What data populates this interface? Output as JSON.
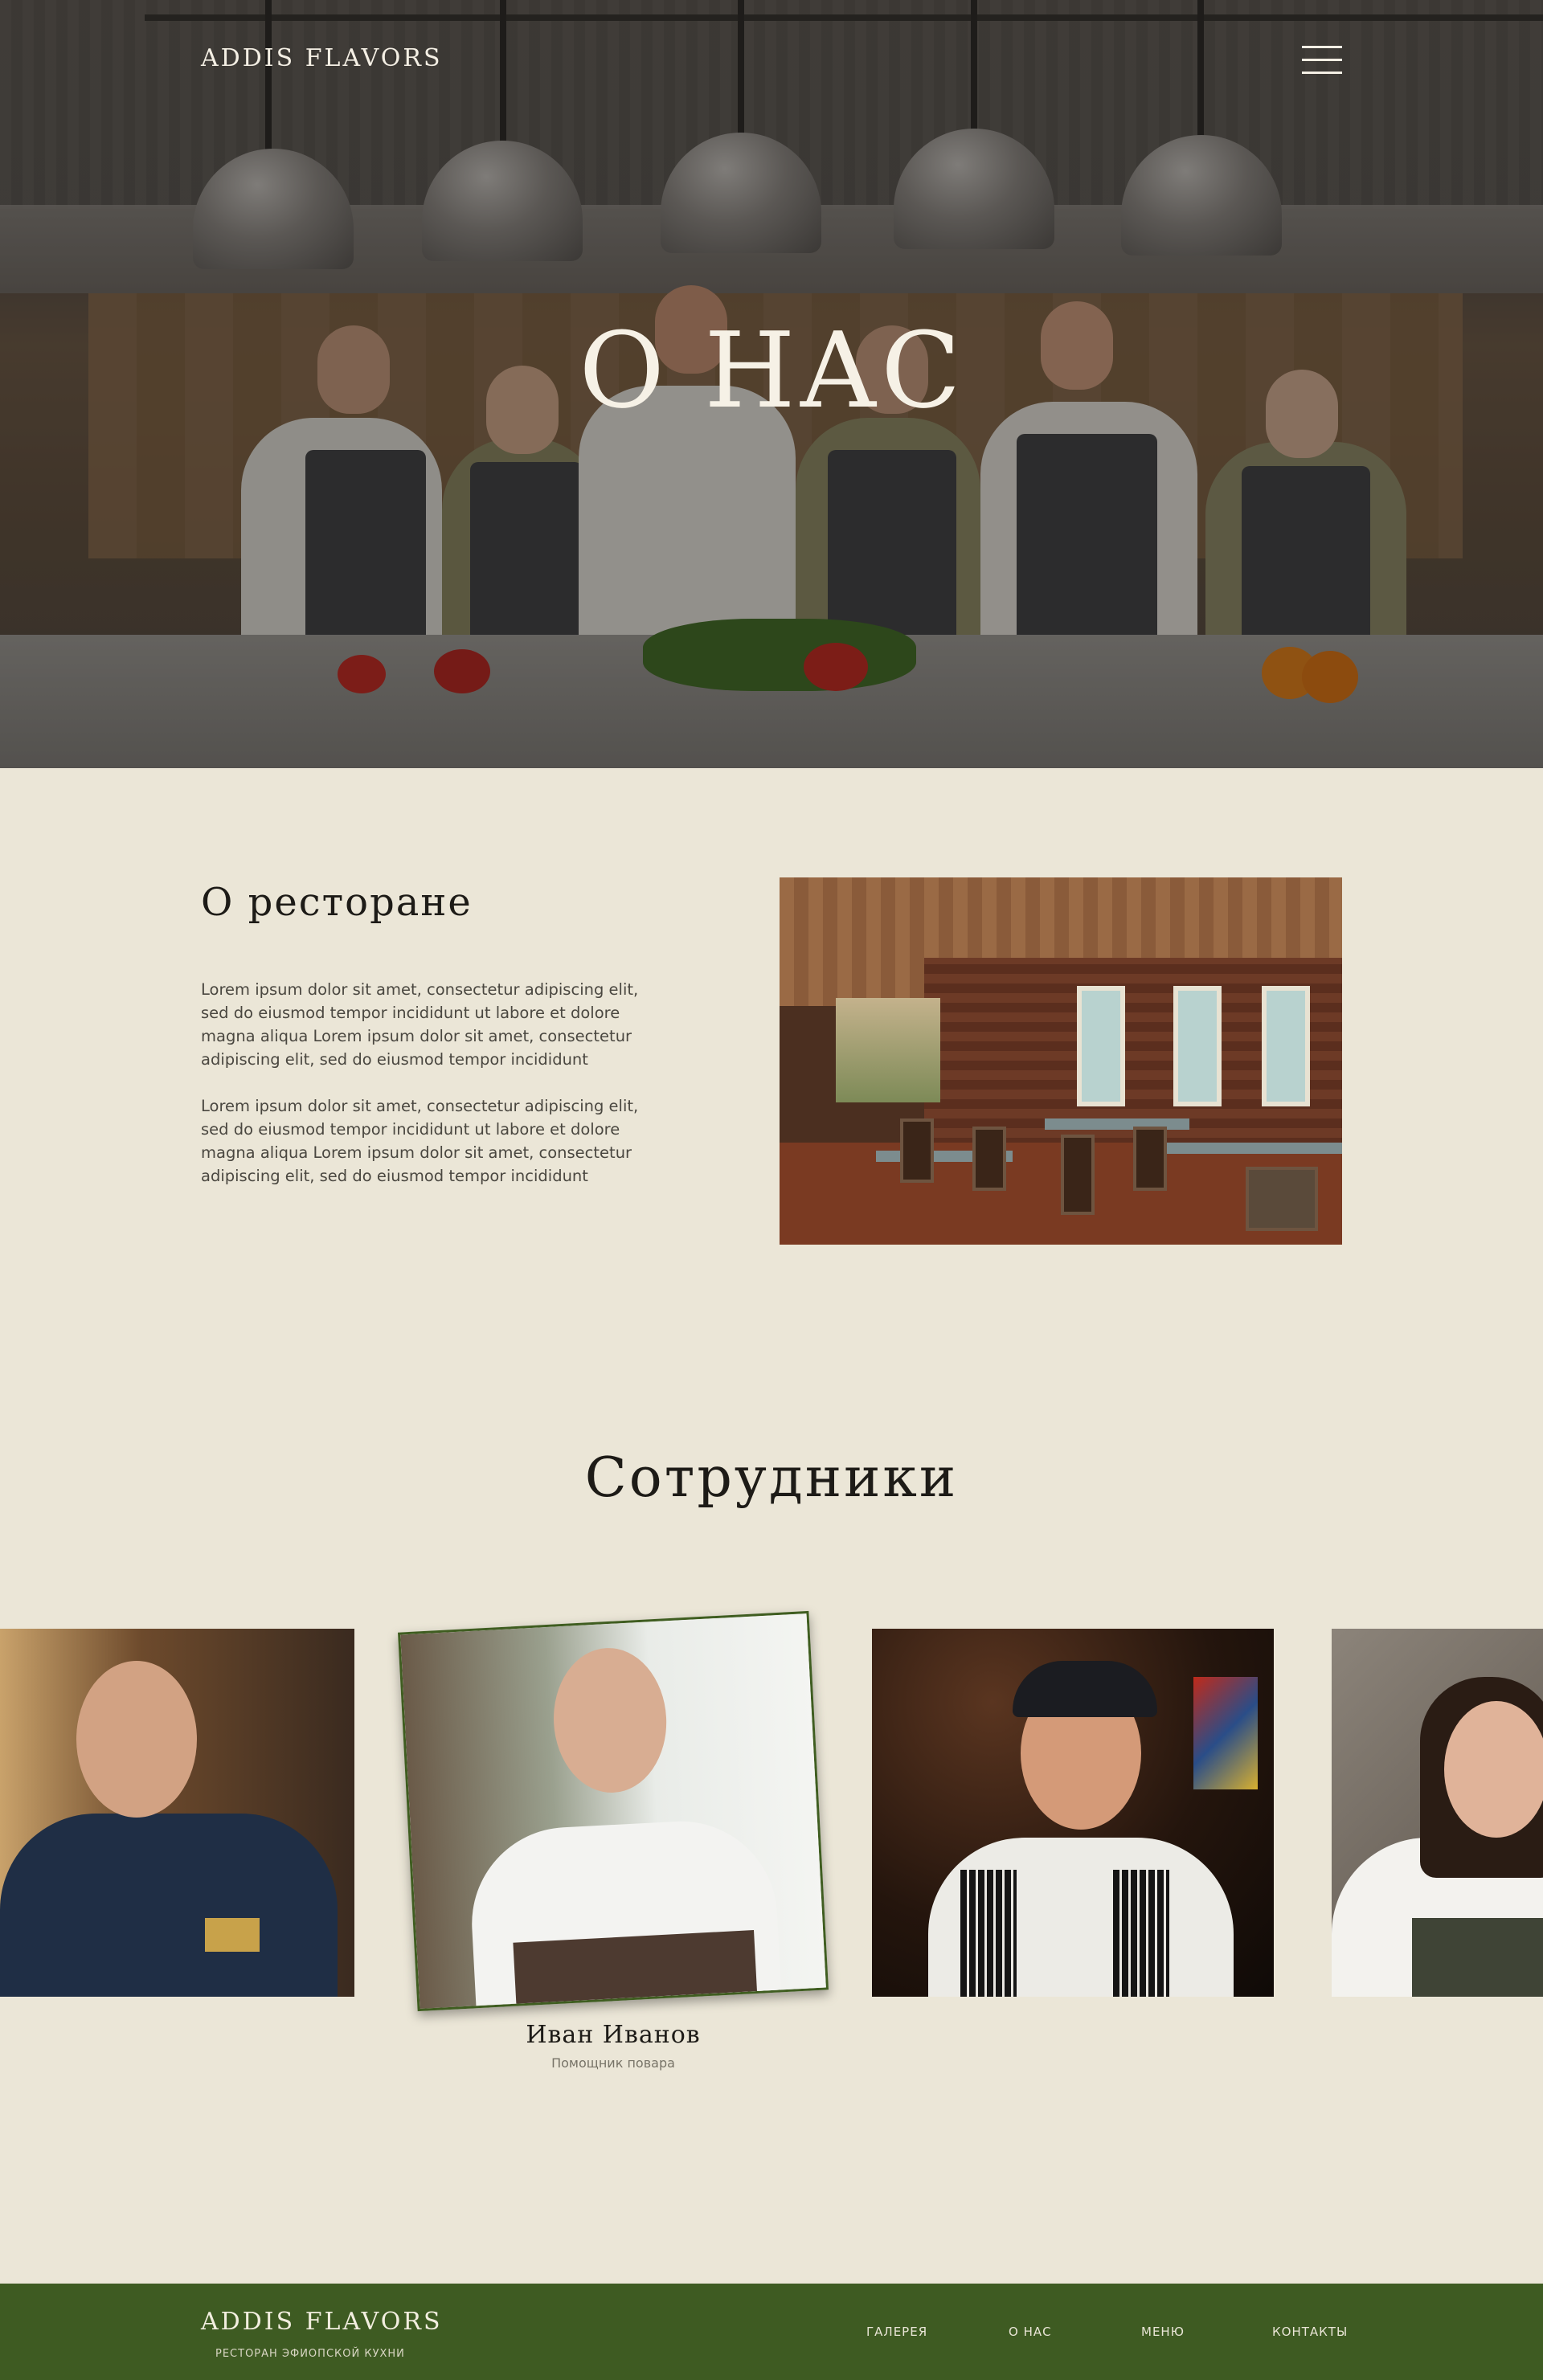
{
  "header": {
    "logo": "ADDIS FLAVORS",
    "menu_icon": "hamburger-icon"
  },
  "hero": {
    "title": "О НАС"
  },
  "about": {
    "title": "О ресторане",
    "paragraphs": [
      "Lorem ipsum dolor sit amet, consectetur adipiscing elit, sed do eiusmod tempor incididunt ut labore et dolore magna aliqua Lorem ipsum dolor sit amet, consectetur adipiscing elit, sed do eiusmod tempor incididunt",
      "Lorem ipsum dolor sit amet, consectetur adipiscing elit, sed do eiusmod tempor incididunt ut labore et dolore magna aliqua Lorem ipsum dolor sit amet, consectetur adipiscing elit, sed do eiusmod tempor incididunt"
    ]
  },
  "staff": {
    "title": "Сотрудники",
    "featured": {
      "name": "Иван Иванов",
      "role": "Помощник повара"
    }
  },
  "footer": {
    "logo": "ADDIS FLAVORS",
    "tagline": "РЕСТОРАН ЭФИОПСКОЙ КУХНИ",
    "nav": [
      "ГАЛЕРЕЯ",
      "О НАС",
      "МЕНЮ",
      "КОНТАКТЫ"
    ]
  },
  "colors": {
    "background": "#ebe6d7",
    "accent_green": "#3e5b22",
    "text_dark": "#1d1b17"
  }
}
